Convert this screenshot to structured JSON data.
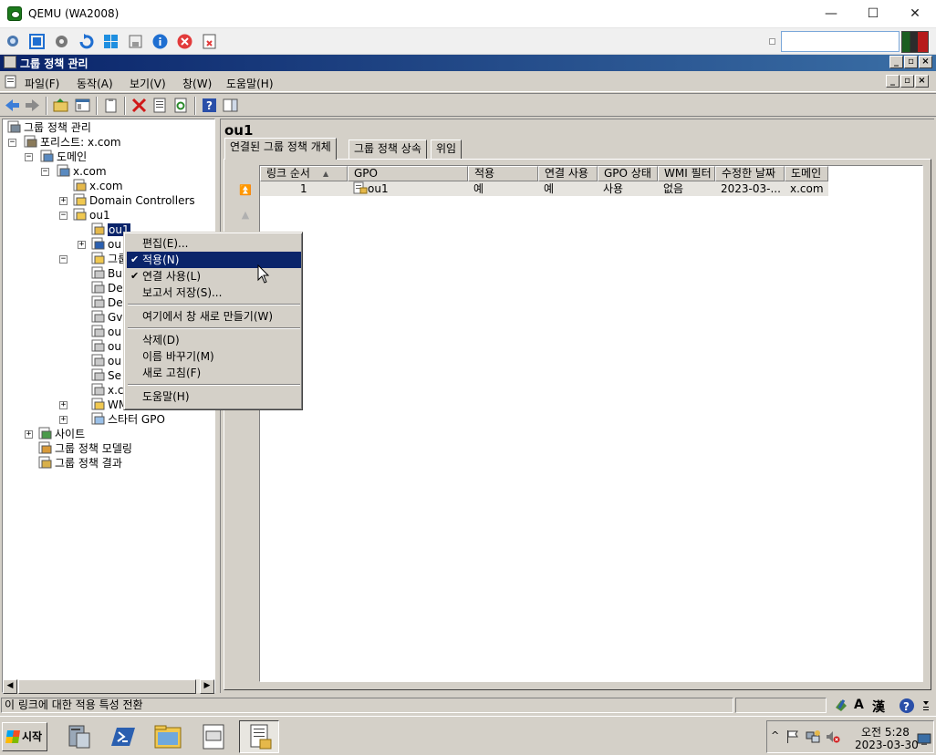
{
  "qemu": {
    "title": "QEMU (WA2008)",
    "controls": {
      "minimize": "—",
      "maximize": "☐",
      "close": "✕"
    },
    "search_value": ""
  },
  "app": {
    "title": "그룹 정책 관리",
    "menu": [
      "파일(F)",
      "동작(A)",
      "보기(V)",
      "창(W)",
      "도움말(H)"
    ]
  },
  "tree": {
    "items": [
      {
        "label": "그룹 정책 관리",
        "icon": "gpm-icon"
      },
      {
        "label": "포리스트: x.com",
        "icon": "forest-icon",
        "exp": "−"
      },
      {
        "label": "도메인",
        "icon": "domains-icon",
        "exp": "−"
      },
      {
        "label": "x.com",
        "icon": "domain-icon",
        "exp": "−"
      },
      {
        "label": "x.com",
        "icon": "gpo-link-icon"
      },
      {
        "label": "Domain Controllers",
        "icon": "ou-folder-icon",
        "exp": "+"
      },
      {
        "label": "ou1",
        "icon": "ou-folder-icon",
        "exp": "−"
      },
      {
        "label": "ou1",
        "icon": "gpo-link-icon",
        "selected": true
      },
      {
        "label": "ou",
        "icon": "ou-info-icon",
        "exp": "+"
      },
      {
        "label": "그룹 정",
        "icon": "gpo-folder-icon",
        "exp": "−"
      },
      {
        "label": "Bu",
        "icon": "gpo-icon"
      },
      {
        "label": "De",
        "icon": "gpo-icon"
      },
      {
        "label": "De",
        "icon": "gpo-icon"
      },
      {
        "label": "Gv",
        "icon": "gpo-icon"
      },
      {
        "label": "ou",
        "icon": "gpo-icon"
      },
      {
        "label": "ou",
        "icon": "gpo-icon"
      },
      {
        "label": "ou",
        "icon": "gpo-icon"
      },
      {
        "label": "Se",
        "icon": "gpo-icon"
      },
      {
        "label": "x.c",
        "icon": "gpo-icon"
      },
      {
        "label": "WMI 필",
        "icon": "wmi-folder-icon",
        "exp": "+"
      },
      {
        "label": "스타터 GPO",
        "icon": "starter-gpo-icon",
        "exp": "+"
      },
      {
        "label": "사이트",
        "icon": "sites-icon",
        "exp": "+"
      },
      {
        "label": "그룹 정책 모델링",
        "icon": "modeling-icon"
      },
      {
        "label": "그룹 정책 결과",
        "icon": "results-icon"
      }
    ]
  },
  "right": {
    "title": "ou1",
    "tabs": [
      "연결된 그룹 정책 개체",
      "그룹 정책 상속",
      "위임"
    ],
    "columns": [
      "링크 순서",
      "GPO",
      "적용",
      "연결 사용",
      "GPO 상태",
      "WMI 필터",
      "수정한 날짜",
      "도메인"
    ],
    "sort_glyph": "▲",
    "rows": [
      [
        "1",
        "ou1",
        "예",
        "예",
        "사용",
        "없음",
        "2023-03-...",
        "x.com"
      ]
    ]
  },
  "context_menu": {
    "items": [
      {
        "label": "편집(E)..."
      },
      {
        "label": "적용(N)",
        "checked": true,
        "highlighted": true
      },
      {
        "label": "연결 사용(L)",
        "checked": true
      },
      {
        "label": "보고서 저장(S)..."
      },
      {
        "separator": true
      },
      {
        "label": "여기에서 창 새로 만들기(W)"
      },
      {
        "separator": true
      },
      {
        "label": "삭제(D)"
      },
      {
        "label": "이름 바꾸기(M)"
      },
      {
        "label": "새로 고침(F)"
      },
      {
        "separator": true
      },
      {
        "label": "도움말(H)"
      }
    ]
  },
  "status": {
    "text": "이 링크에 대한 적용 특성 전환",
    "ime_a": "A",
    "ime_han": "漢"
  },
  "taskbar": {
    "start_label": "시작",
    "time": "오전 5:28",
    "date": "2023-03-30"
  },
  "colors": {
    "title_bar": "#0a246a",
    "selection": "#0a246a",
    "face": "#d4d0c8"
  }
}
